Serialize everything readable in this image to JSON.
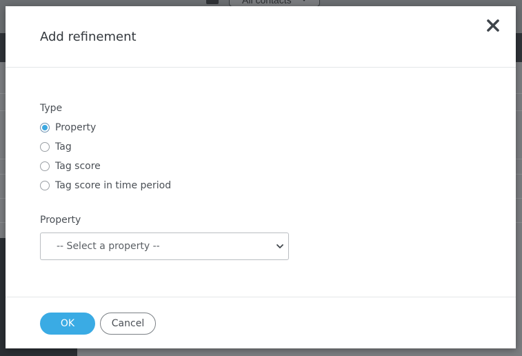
{
  "background": {
    "contacts_filter_label": "All contacts"
  },
  "modal": {
    "title": "Add refinement",
    "type_section": {
      "label": "Type",
      "options": [
        {
          "label": "Property",
          "checked": true
        },
        {
          "label": "Tag",
          "checked": false
        },
        {
          "label": "Tag score",
          "checked": false
        },
        {
          "label": "Tag score in time period",
          "checked": false
        }
      ]
    },
    "property_section": {
      "label": "Property",
      "selected": "-- Select a property --"
    },
    "footer": {
      "ok_label": "OK",
      "cancel_label": "Cancel"
    }
  },
  "colors": {
    "primary": "#3aabe4",
    "radio_checked": "#3da8e0"
  }
}
